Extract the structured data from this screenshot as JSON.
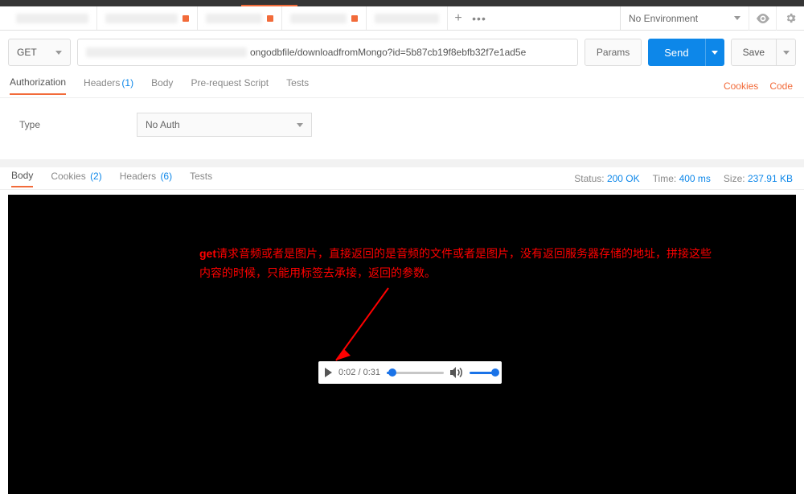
{
  "env": {
    "label": "No Environment"
  },
  "request": {
    "method": "GET",
    "url_visible": "ongodbfile/downloadfromMongo?id=5b87cb19f8ebfb32f7e1ad5e",
    "params_label": "Params",
    "send_label": "Send",
    "save_label": "Save"
  },
  "req_tabs": {
    "authorization": "Authorization",
    "headers": "Headers",
    "headers_count": "(1)",
    "body": "Body",
    "prerequest": "Pre-request Script",
    "tests": "Tests",
    "cookies": "Cookies",
    "code": "Code"
  },
  "auth": {
    "type_label": "Type",
    "selected": "No Auth"
  },
  "resp_tabs": {
    "body": "Body",
    "cookies": "Cookies",
    "cookies_count": "(2)",
    "headers": "Headers",
    "headers_count": "(6)",
    "tests": "Tests"
  },
  "resp_meta": {
    "status_lbl": "Status:",
    "status_val": "200 OK",
    "time_lbl": "Time:",
    "time_val": "400 ms",
    "size_lbl": "Size:",
    "size_val": "237.91 KB"
  },
  "annotation": {
    "lead": "get",
    "line1": "请求音频或者是图片，直接返回的是音频的文件或者是图片，没有返回服务器存储的地址，拼接这些",
    "line2": "内容的时候，只能用标签去承接，返回的参数。"
  },
  "audio": {
    "current": "0:02",
    "duration": "0:31"
  }
}
